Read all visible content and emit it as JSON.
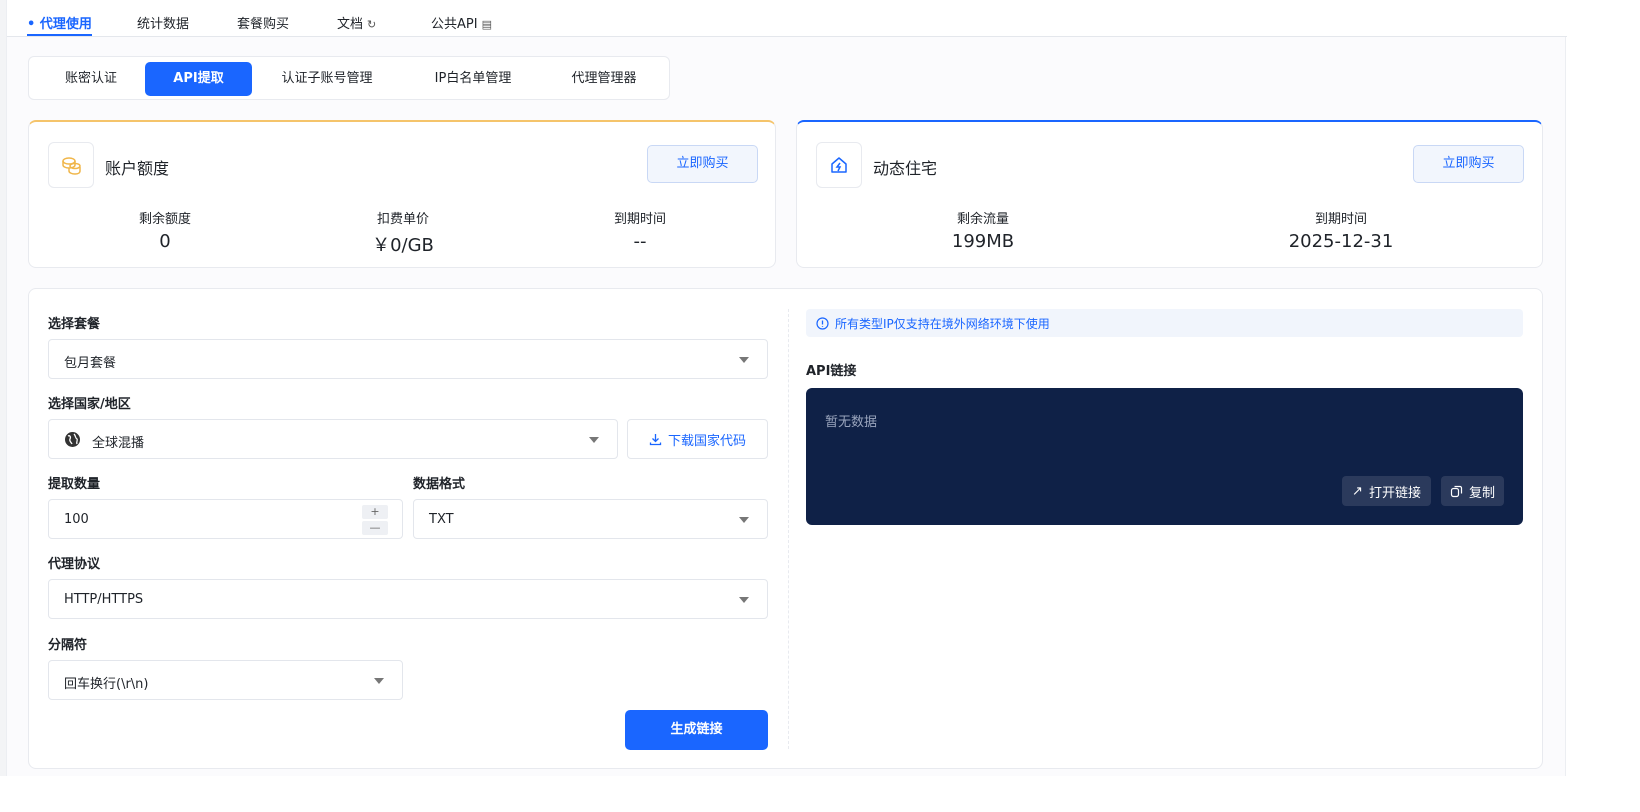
{
  "topnav": {
    "items": [
      {
        "label": "• 代理使用"
      },
      {
        "label": "统计数据"
      },
      {
        "label": "套餐购买"
      },
      {
        "label": "文档"
      },
      {
        "label": "公共API"
      }
    ]
  },
  "subtabs": [
    {
      "label": "账密认证"
    },
    {
      "label": "API提取"
    },
    {
      "label": "认证子账号管理"
    },
    {
      "label": "IP白名单管理"
    },
    {
      "label": "代理管理器"
    }
  ],
  "account_card": {
    "title": "账户额度",
    "buy_label": "立即购买",
    "stats": [
      {
        "label": "剩余额度",
        "value": "0"
      },
      {
        "label": "扣费单价",
        "value": "￥0/GB"
      },
      {
        "label": "到期时间",
        "value": "--"
      }
    ]
  },
  "residential_card": {
    "title": "动态住宅",
    "buy_label": "立即购买",
    "stats": [
      {
        "label": "剩余流量",
        "value": "199MB"
      },
      {
        "label": "到期时间",
        "value": "2025-12-31"
      }
    ]
  },
  "form": {
    "package_label": "选择套餐",
    "package_value": "包月套餐",
    "country_label": "选择国家/地区",
    "country_value": "全球混播",
    "download_label": "下载国家代码",
    "quantity_label": "提取数量",
    "quantity_value": "100",
    "format_label": "数据格式",
    "format_value": "TXT",
    "protocol_label": "代理协议",
    "protocol_value": "HTTP/HTTPS",
    "separator_label": "分隔符",
    "separator_value": "回车换行(\\r\\n)",
    "generate_label": "生成链接"
  },
  "api": {
    "notice": "所有类型IP仅支持在境外网络环境下使用",
    "link_label": "API链接",
    "empty_text": "暂无数据",
    "open_label": "打开链接",
    "copy_label": "复制"
  },
  "colors": {
    "accent": "#1a66ff",
    "gold": "#f5c46b",
    "api_box": "#0f2147"
  }
}
